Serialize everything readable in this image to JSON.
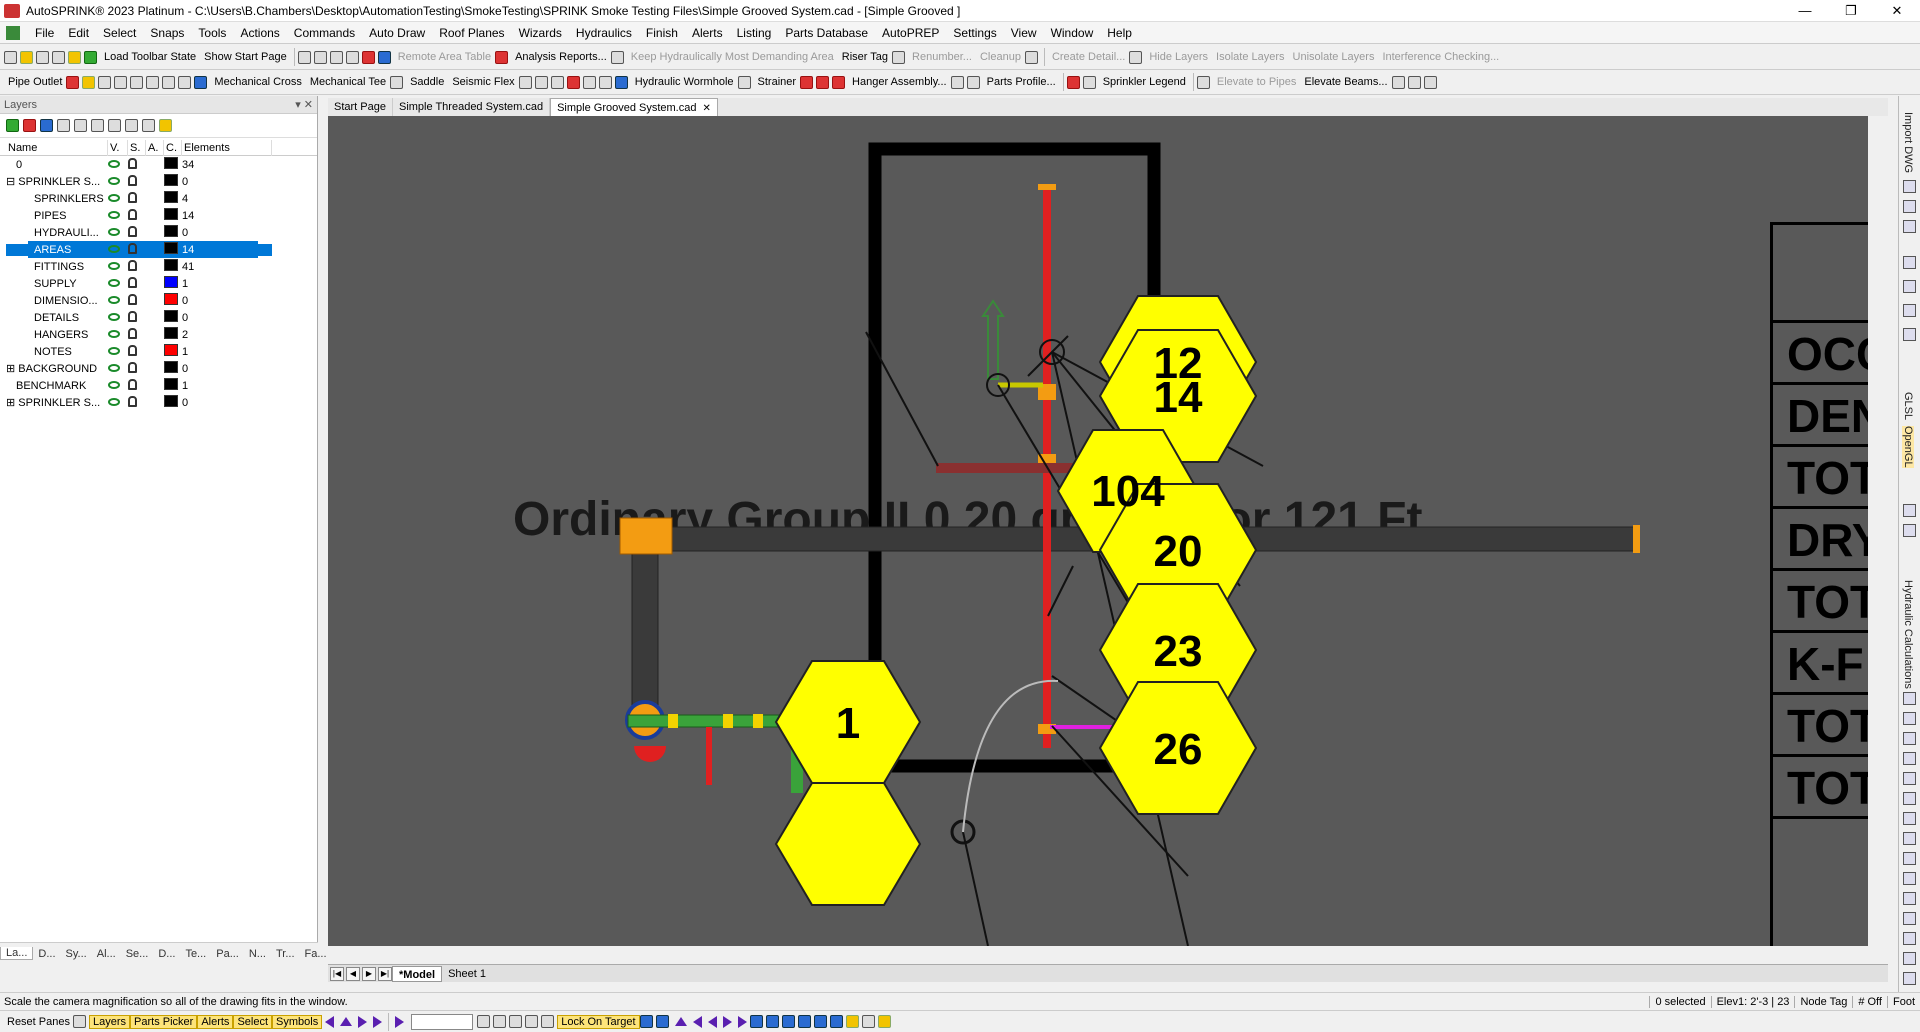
{
  "window": {
    "title": "AutoSPRINK® 2023 Platinum - C:\\Users\\B.Chambers\\Desktop\\AutomationTesting\\SmokeTesting\\SPRINK Smoke Testing Files\\Simple Grooved System.cad - [Simple Grooved ]",
    "min": "—",
    "max": "❐",
    "close": "✕"
  },
  "menu": [
    "File",
    "Edit",
    "Select",
    "Snaps",
    "Tools",
    "Actions",
    "Commands",
    "Auto Draw",
    "Roof Planes",
    "Wizards",
    "Hydraulics",
    "Finish",
    "Alerts",
    "Listing",
    "Parts Database",
    "AutoPREP",
    "Settings",
    "View",
    "Window",
    "Help"
  ],
  "toolbar1": {
    "load_toolbar_state": "Load Toolbar State",
    "show_start_page": "Show Start Page",
    "remote_area_table": "Remote Area Table",
    "analysis_reports": "Analysis Reports...",
    "keep_hydraulic": "Keep Hydraulically Most Demanding Area",
    "riser_tag": "Riser Tag",
    "renumber": "Renumber...",
    "cleanup": "Cleanup",
    "create_detail": "Create Detail...",
    "hide_layers": "Hide Layers",
    "isolate_layers": "Isolate Layers",
    "unisolate_layers": "Unisolate Layers",
    "interference": "Interference Checking..."
  },
  "toolbar2": {
    "pipe_outlet": "Pipe Outlet",
    "mechanical_cross": "Mechanical Cross",
    "mechanical_tee": "Mechanical Tee",
    "saddle": "Saddle",
    "seismic_flex": "Seismic Flex",
    "hydraulic_wormhole": "Hydraulic Wormhole",
    "strainer": "Strainer",
    "hanger_assembly": "Hanger Assembly...",
    "parts_profile": "Parts Profile...",
    "sprinkler_legend": "Sprinkler Legend",
    "elevate_to_pipes": "Elevate to Pipes",
    "elevate_beams": "Elevate Beams..."
  },
  "layers": {
    "title": "Layers",
    "pin": "▾ ✕",
    "headers": [
      "Name",
      "V.",
      "S.",
      "A.",
      "C.",
      "Elements"
    ],
    "rows": [
      {
        "name": "0",
        "count": "34",
        "color": "#000000",
        "indent": 0,
        "expander": ""
      },
      {
        "name": "SPRINKLER S...",
        "count": "0",
        "color": "#000000",
        "indent": 0,
        "expander": "⊟"
      },
      {
        "name": "SPRINKLERS",
        "count": "4",
        "color": "#000000",
        "indent": 2,
        "expander": ""
      },
      {
        "name": "PIPES",
        "count": "14",
        "color": "#000000",
        "indent": 2,
        "expander": ""
      },
      {
        "name": "HYDRAULI...",
        "count": "0",
        "color": "#000000",
        "indent": 2,
        "expander": ""
      },
      {
        "name": "AREAS",
        "count": "14",
        "color": "#000000",
        "indent": 2,
        "expander": "",
        "selected": true
      },
      {
        "name": "FITTINGS",
        "count": "41",
        "color": "#000000",
        "indent": 2,
        "expander": ""
      },
      {
        "name": "SUPPLY",
        "count": "1",
        "color": "#0000ff",
        "indent": 2,
        "expander": ""
      },
      {
        "name": "DIMENSIO...",
        "count": "0",
        "color": "#ff0000",
        "indent": 2,
        "expander": ""
      },
      {
        "name": "DETAILS",
        "count": "0",
        "color": "#000000",
        "indent": 2,
        "expander": ""
      },
      {
        "name": "HANGERS",
        "count": "2",
        "color": "#000000",
        "indent": 2,
        "expander": ""
      },
      {
        "name": "NOTES",
        "count": "1",
        "color": "#ff0000",
        "indent": 2,
        "expander": ""
      },
      {
        "name": "BACKGROUND",
        "count": "0",
        "color": "#000000",
        "indent": 0,
        "expander": "⊞"
      },
      {
        "name": "BENCHMARK",
        "count": "1",
        "color": "#000000",
        "indent": 0,
        "expander": ""
      },
      {
        "name": "SPRINKLER S...",
        "count": "0",
        "color": "#000000",
        "indent": 0,
        "expander": "⊞"
      }
    ],
    "bottom_tabs": [
      "La...",
      "D...",
      "Sy...",
      "Al...",
      "Se...",
      "D...",
      "Te...",
      "Pa...",
      "N...",
      "Tr...",
      "Fa..."
    ]
  },
  "doc_tabs": [
    "Start Page",
    "Simple Threaded System.cad",
    "Simple Grooved System.cad"
  ],
  "drawing": {
    "area_label": "Ordinary Group II 0.20 gpm/ft² for 121 Ft",
    "hex_tags": [
      "12",
      "14",
      "104",
      "20",
      "23",
      "26",
      "1"
    ],
    "legend_rows": [
      "OCC",
      "DEN",
      "TOT",
      "DRY",
      "TOT",
      "K-F",
      "TOT",
      "TOT"
    ]
  },
  "sheet_tabs": [
    "*Model",
    "Sheet 1"
  ],
  "right_tabs": [
    "Import DWG",
    "GLSL",
    "OpenGL",
    "Hydraulic Calculations"
  ],
  "status": {
    "message": "Scale the camera magnification so all of the drawing fits in the window.",
    "selected": "0 selected",
    "elev": "Elev1: 2'-3 | 23",
    "node_tag": "Node Tag",
    "off": "# Off",
    "foot": "Foot"
  },
  "bottom": {
    "reset_panes": "Reset Panes",
    "layers": "Layers",
    "parts_picker": "Parts Picker",
    "alerts": "Alerts",
    "select": "Select",
    "symbols": "Symbols",
    "lock_on_target": "Lock On Target"
  }
}
